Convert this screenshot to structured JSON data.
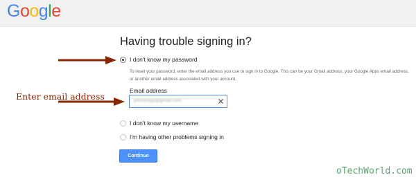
{
  "header": {
    "logo_letters": [
      "G",
      "o",
      "o",
      "g",
      "l",
      "e"
    ]
  },
  "main": {
    "title": "Having trouble signing in?",
    "options": [
      {
        "label": "I don't know my password",
        "selected": true
      },
      {
        "label": "I don't know my username",
        "selected": false
      },
      {
        "label": "I'm having other problems signing in",
        "selected": false
      }
    ],
    "description": "To reset your password, enter the email address you use to sign in to Google. This can be your Gmail address, your Google Apps email address, or another email address associated with your account.",
    "email_label": "Email address",
    "email_value": "johnsmyp@gmail.com",
    "continue_label": "Continue"
  },
  "annotation": {
    "text": "Enter email address",
    "arrow_color": "#8b2500"
  },
  "watermark": "oTechWorld.com",
  "colors": {
    "google_blue": "#4285f4",
    "google_red": "#ea4335",
    "google_yellow": "#fbbc05",
    "google_green": "#34a853",
    "button_blue": "#4d90fe",
    "annotation": "#8b2500",
    "watermark": "#5aa36e"
  },
  "icons": {
    "email_clear": "close-icon",
    "annotation_arrow": "arrow-right-icon"
  }
}
